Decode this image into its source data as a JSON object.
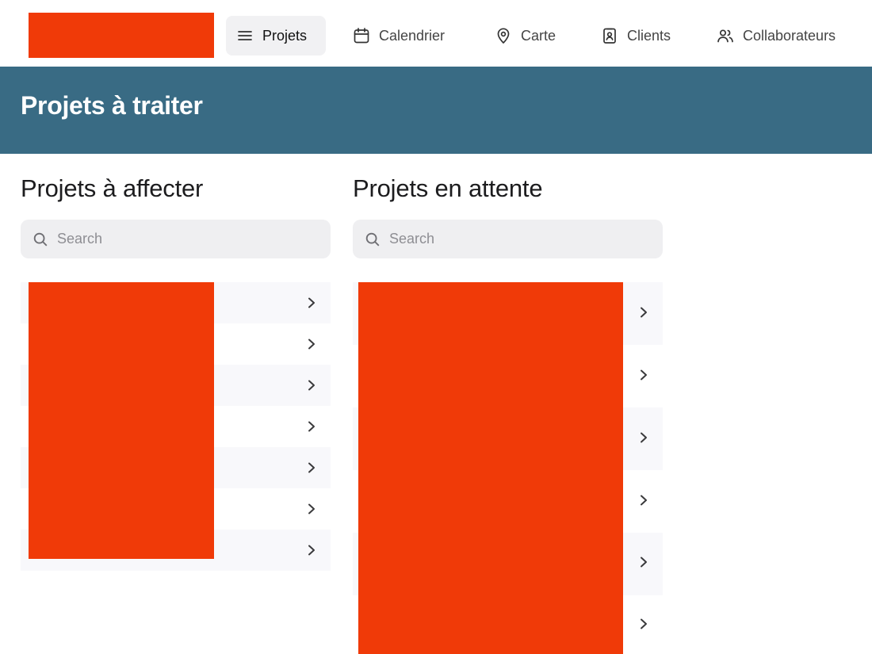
{
  "brand": {
    "redaction_color": "#f03a08",
    "banner_color": "#396b84"
  },
  "nav": {
    "items": [
      {
        "label": "Projets",
        "icon": "menu-icon",
        "active": true
      },
      {
        "label": "Calendrier",
        "icon": "calendar-icon",
        "active": false
      },
      {
        "label": "Carte",
        "icon": "map-pin-icon",
        "active": false
      },
      {
        "label": "Clients",
        "icon": "contact-card-icon",
        "active": false
      },
      {
        "label": "Collaborateurs",
        "icon": "users-icon",
        "active": false
      }
    ]
  },
  "banner": {
    "title": "Projets à traiter"
  },
  "columns": [
    {
      "title": "Projets à affecter",
      "search": {
        "placeholder": "Search",
        "value": ""
      },
      "row_count": 7,
      "rows_redacted": true
    },
    {
      "title": "Projets en attente",
      "search": {
        "placeholder": "Search",
        "value": ""
      },
      "row_count": 6,
      "rows_redacted": true
    }
  ]
}
